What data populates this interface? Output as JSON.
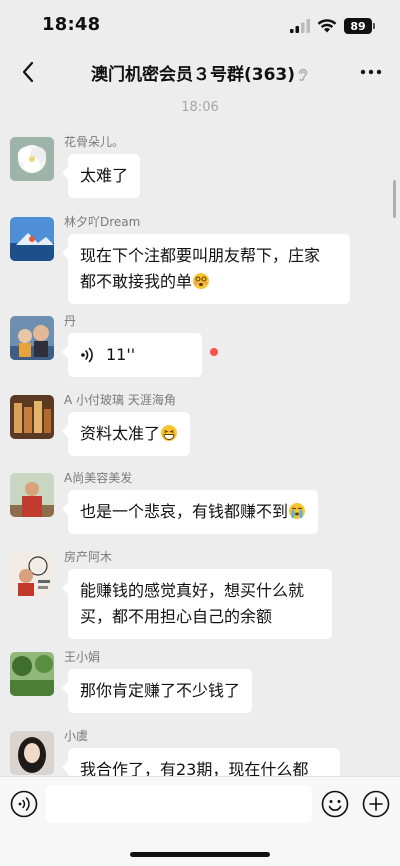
{
  "status_bar": {
    "time": "18:48",
    "battery": "89"
  },
  "nav": {
    "title": "澳门机密会员３号群(363)"
  },
  "chat": {
    "timestamp": "18:06",
    "messages": [
      {
        "sender": "花骨朵儿。",
        "text": "太难了"
      },
      {
        "sender": "林夕吖Dream",
        "line1": "现在下个注都要叫朋友帮下，庄家",
        "line2": "都不敢接我的单"
      },
      {
        "sender": "丹",
        "voice_duration": "11''"
      },
      {
        "sender": "A 小付玻璃 天涯海角",
        "text": "资料太准了"
      },
      {
        "sender": "A尚美容美发",
        "text": "也是一个悲哀，有钱都赚不到"
      },
      {
        "sender": "房产阿木",
        "line1": "能赚钱的感觉真好，想买什么就",
        "line2": "买，都不用担心自己的余额"
      },
      {
        "sender": "王小娟",
        "text": "那你肯定赚了不少钱了"
      },
      {
        "sender": "小虞",
        "text": "我合作了，有23期，现在什么都"
      }
    ]
  },
  "input": {
    "placeholder": ""
  },
  "icons": {
    "back": "chevron-left-icon",
    "more": "more-dots-icon",
    "ear": "ear-icon",
    "voice_toggle": "voice-mode-icon",
    "emoji": "emoji-icon",
    "plus": "plus-icon"
  },
  "colors": {
    "background": "#ededed",
    "bubble": "#ffffff",
    "unread_dot": "#fa5151"
  }
}
